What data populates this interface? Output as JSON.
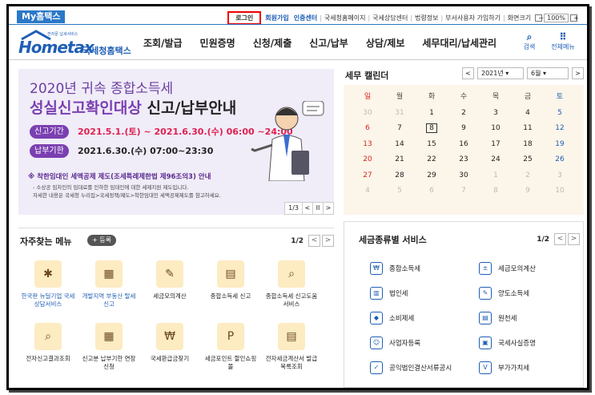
{
  "util": {
    "my_tab": "My홈택스",
    "login": "로그인",
    "signup": "회원가입",
    "cert": "인증센터",
    "links": [
      "국세청홈페이지",
      "국세상담센터",
      "법령정보",
      "부서사용자 가입하기",
      "화면크기"
    ],
    "zoom": "100%",
    "zoom_minus": "−",
    "zoom_plus": "+"
  },
  "header": {
    "logo_main": "Hometax",
    "logo_sub": "국세청홈택스",
    "logo_tiny": "전자문 납세서비스",
    "nav": [
      "조회/발급",
      "민원증명",
      "신청/제출",
      "신고/납부",
      "상담/제보",
      "세무대리/납세관리"
    ],
    "search": "검색",
    "menu": "전체메뉴",
    "search_glyph": "⌕",
    "menu_glyph": "⠿"
  },
  "banner": {
    "title1": "2020년 귀속 종합소득세",
    "title2_a": "성실신고확인대상",
    "title2_b": " 신고/납부안내",
    "pill1": "신고기간",
    "date1": "2021.5.1.(토) ~ 2021.6.30.(수) 06:00 ~24:00",
    "pill2": "납부기한",
    "date2": "2021.6.30.(수) 07:00~23:30",
    "notice": "※ 착한임대인 세액공제 제도(조세특례제한법 제96조의3) 안내",
    "note1": "- 소상공 임차인의 임대료를 인하한 임대인에 대한 세제지원 제도입니다.",
    "note2": "자세한 내용은 국세청 누리집>국세정책/제도>착한임대인 세액공제제도를 참고하세요.",
    "page": "1/3",
    "prev": "<",
    "pause": "II",
    "next": ">"
  },
  "calendar": {
    "title": "세무 캘린더",
    "year": "2021년",
    "month": "6월",
    "prev": "<",
    "next": ">",
    "weekdays": [
      "일",
      "월",
      "화",
      "수",
      "목",
      "금",
      "토"
    ],
    "days": [
      [
        "30",
        "31",
        "1",
        "2",
        "3",
        "4",
        "5"
      ],
      [
        "6",
        "7",
        "8",
        "9",
        "10",
        "11",
        "12"
      ],
      [
        "13",
        "14",
        "15",
        "16",
        "17",
        "18",
        "19"
      ],
      [
        "20",
        "21",
        "22",
        "23",
        "24",
        "25",
        "26"
      ],
      [
        "27",
        "28",
        "29",
        "30",
        "1",
        "2",
        "3"
      ],
      [
        "4",
        "5",
        "6",
        "7",
        "8",
        "9",
        "10"
      ]
    ],
    "today": "8"
  },
  "favorites": {
    "title": "자주찾는 메뉴",
    "add": "+ 등록",
    "page": "1/2",
    "prev": "<",
    "next": ">",
    "items": [
      {
        "label": "한국판 뉴딜기업 국세상담서비스",
        "glyph": "✱",
        "icon": "new-deal-icon",
        "highlight": true
      },
      {
        "label": "개발지역 부동산 탈세신고",
        "glyph": "▦",
        "icon": "building-icon",
        "highlight": true
      },
      {
        "label": "세금모의계산",
        "glyph": "✎",
        "icon": "calculator-icon",
        "highlight": false
      },
      {
        "label": "종합소득세 신고",
        "glyph": "▤",
        "icon": "calendar-form-icon",
        "highlight": false
      },
      {
        "label": "종합소득세 신고도움 서비스",
        "glyph": "⌕",
        "icon": "document-search-icon",
        "highlight": false
      },
      {
        "label": "전자신고결과조회",
        "glyph": "⌕",
        "icon": "result-search-icon",
        "highlight": false
      },
      {
        "label": "신고분 납부기한 연장 신청",
        "glyph": "▦",
        "icon": "calendar-extend-icon",
        "highlight": false
      },
      {
        "label": "국세환급금찾기",
        "glyph": "₩",
        "icon": "refund-icon",
        "highlight": false
      },
      {
        "label": "세금포인트 할인쇼핑몰",
        "glyph": "P",
        "icon": "point-bag-icon",
        "highlight": false
      },
      {
        "label": "전자세금계산서 발급목록조회",
        "glyph": "▤",
        "icon": "invoice-list-icon",
        "highlight": false
      }
    ]
  },
  "tax": {
    "title": "세금종류별 서비스",
    "page": "1/2",
    "prev": "<",
    "next": ">",
    "items": [
      {
        "label": "종합소득세",
        "glyph": "₩",
        "icon": "income-tax-icon"
      },
      {
        "label": "세금모의계산",
        "glyph": "±",
        "icon": "tax-calc-icon"
      },
      {
        "label": "법인세",
        "glyph": "▥",
        "icon": "corporate-tax-icon"
      },
      {
        "label": "양도소득세",
        "glyph": "✎",
        "icon": "transfer-tax-icon"
      },
      {
        "label": "소비제세",
        "glyph": "◆",
        "icon": "consumption-tax-icon"
      },
      {
        "label": "원천세",
        "glyph": "▤",
        "icon": "withholding-tax-icon"
      },
      {
        "label": "사업자등록",
        "glyph": "☺",
        "icon": "business-reg-icon"
      },
      {
        "label": "국세사실증명",
        "glyph": "▣",
        "icon": "tax-cert-icon"
      },
      {
        "label": "공익법인결산서류공시",
        "glyph": "✓",
        "icon": "public-corp-icon"
      },
      {
        "label": "부가가치세",
        "glyph": "V",
        "icon": "vat-icon"
      }
    ]
  }
}
